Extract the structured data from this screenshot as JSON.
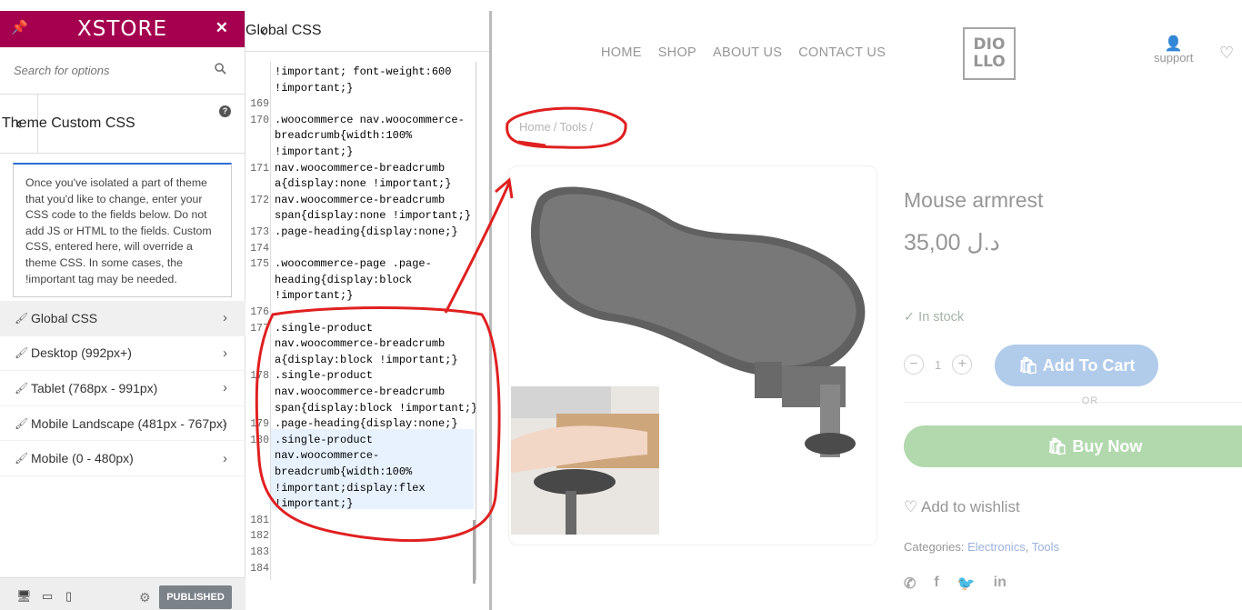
{
  "sidebar": {
    "brand": "XSTORE",
    "search_placeholder": "Search for options",
    "section_title": "Theme Custom CSS",
    "notice": "Once you've isolated a part of theme that you'd like to change, enter your CSS code to the fields below. Do not add JS or HTML to the fields. Custom CSS, entered here, will override a theme CSS. In some cases, the !important tag may be needed.",
    "items": [
      {
        "label": "Global CSS"
      },
      {
        "label": "Desktop (992px+)"
      },
      {
        "label": "Tablet (768px - 991px)"
      },
      {
        "label": "Mobile Landscape (481px - 767px)"
      },
      {
        "label": "Mobile (0 - 480px)"
      }
    ],
    "publish_label": "PUBLISHED"
  },
  "editor": {
    "title": "Global CSS",
    "lines": [
      {
        "num": "",
        "text": "!important; font-weight:600"
      },
      {
        "num": "",
        "text": "!important;}"
      },
      {
        "num": "169",
        "text": ""
      },
      {
        "num": "170",
        "text": ".woocommerce nav.woocommerce-"
      },
      {
        "num": "",
        "text": "breadcrumb{width:100%"
      },
      {
        "num": "",
        "text": "!important;}"
      },
      {
        "num": "171",
        "text": "nav.woocommerce-breadcrumb"
      },
      {
        "num": "",
        "text": "a{display:none !important;}"
      },
      {
        "num": "172",
        "text": "nav.woocommerce-breadcrumb"
      },
      {
        "num": "",
        "text": "span{display:none !important;}"
      },
      {
        "num": "173",
        "text": ".page-heading{display:none;}"
      },
      {
        "num": "174",
        "text": ""
      },
      {
        "num": "175",
        "text": ".woocommerce-page .page-"
      },
      {
        "num": "",
        "text": "heading{display:block"
      },
      {
        "num": "",
        "text": "!important;}"
      },
      {
        "num": "176",
        "text": ""
      },
      {
        "num": "177",
        "text": ".single-product"
      },
      {
        "num": "",
        "text": "nav.woocommerce-breadcrumb"
      },
      {
        "num": "",
        "text": "a{display:block !important;}"
      },
      {
        "num": "178",
        "text": ".single-product"
      },
      {
        "num": "",
        "text": "nav.woocommerce-breadcrumb"
      },
      {
        "num": "",
        "text": "span{display:block !important;}"
      },
      {
        "num": "179",
        "text": ".page-heading{display:none;}"
      },
      {
        "num": "180",
        "text": ".single-product"
      },
      {
        "num": "",
        "text": "nav.woocommerce-"
      },
      {
        "num": "",
        "text": "breadcrumb{width:100%"
      },
      {
        "num": "",
        "text": "!important;display:flex"
      },
      {
        "num": "",
        "text": "!important;}"
      },
      {
        "num": "181",
        "text": ""
      },
      {
        "num": "182",
        "text": ""
      },
      {
        "num": "183",
        "text": ""
      },
      {
        "num": "184",
        "text": ""
      }
    ]
  },
  "site": {
    "nav": [
      "HOME",
      "SHOP",
      "ABOUT US",
      "CONTACT US"
    ],
    "logo_line1": "DIO",
    "logo_line2": "LLO",
    "support_label": "support",
    "breadcrumb": [
      "Home",
      "Tools"
    ],
    "product_title": "Mouse armrest",
    "price": "35,00 د.ل",
    "stock": "✓ In stock",
    "qty": "1",
    "add_to_cart": "Add To Cart",
    "or": "OR",
    "buy_now": "Buy Now",
    "wishlist": "♡ Add to wishlist",
    "categories_label": "Categories:",
    "categories": [
      "Electronics",
      "Tools"
    ]
  },
  "colors": {
    "brand": "#a4004f",
    "publish": "#7b8289",
    "annotation": "#e02020"
  }
}
